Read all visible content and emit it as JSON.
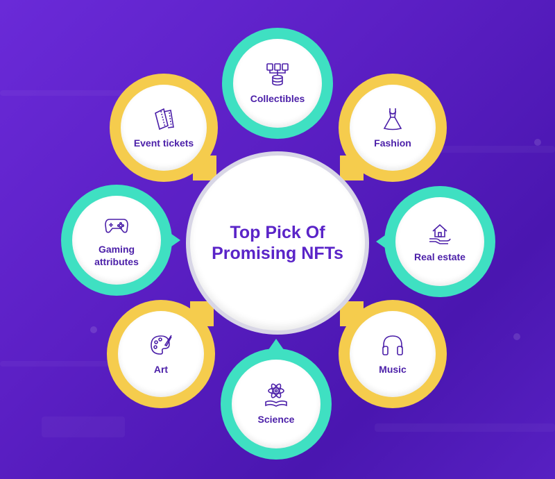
{
  "center": {
    "title": "Top Pick Of Promising NFTs"
  },
  "nodes": {
    "collectibles": "Collectibles",
    "event_tickets": "Event tickets",
    "fashion": "Fashion",
    "gaming": "Gaming attributes",
    "real_estate": "Real estate",
    "art": "Art",
    "music": "Music",
    "science": "Science"
  },
  "colors": {
    "background": "#5b1fc4",
    "teal": "#3fe0c2",
    "yellow": "#f5cc4d",
    "label": "#4b1fa8",
    "title": "#5a24c8"
  },
  "icons": {
    "collectibles": "server-stack-icon",
    "event_tickets": "tickets-icon",
    "fashion": "dress-icon",
    "gaming": "gamepad-icon",
    "real_estate": "house-hand-icon",
    "art": "palette-icon",
    "music": "headphones-icon",
    "science": "atom-book-icon"
  }
}
